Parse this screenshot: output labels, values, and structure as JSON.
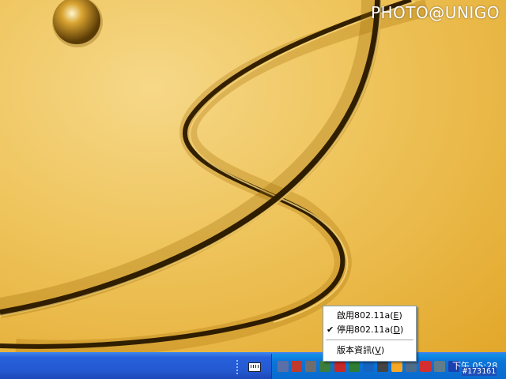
{
  "watermark": "PHOTO@UNIGO",
  "context_menu": {
    "items": [
      {
        "label": "啟用802.11a",
        "mnemonic": "E",
        "checked": false
      },
      {
        "label": "停用802.11a",
        "mnemonic": "D",
        "checked": true
      },
      {
        "label": "版本資訊",
        "mnemonic": "V",
        "checked": false
      }
    ],
    "check_glyph": "✔"
  },
  "taskbar": {
    "clock": "下午 05:28",
    "image_tag": "#173161"
  },
  "tray_icons": [
    {
      "name": "network-disconnected-icon",
      "color": "#5a6fa8"
    },
    {
      "name": "network-x-icon",
      "color": "#c0392b"
    },
    {
      "name": "sound-icon",
      "color": "#6d6d6d"
    },
    {
      "name": "pen-icon",
      "color": "#3b7d3b"
    },
    {
      "name": "security-shield-icon",
      "color": "#c62828"
    },
    {
      "name": "update-icon",
      "color": "#2e7d32"
    },
    {
      "name": "sync-icon",
      "color": "#1565c0"
    },
    {
      "name": "power-off-icon",
      "color": "#444444"
    },
    {
      "name": "eco-icon",
      "color": "#f9a825"
    },
    {
      "name": "device-icon",
      "color": "#4e6d8a"
    },
    {
      "name": "wireless-x-icon",
      "color": "#d32f2f"
    },
    {
      "name": "monitor-icon",
      "color": "#607d8b"
    },
    {
      "name": "blue-window-icon",
      "color": "#1a3fb0"
    }
  ],
  "colors": {
    "taskbar": "#2458d0",
    "tray": "#0c75d8",
    "desktop": "#eec35a"
  }
}
